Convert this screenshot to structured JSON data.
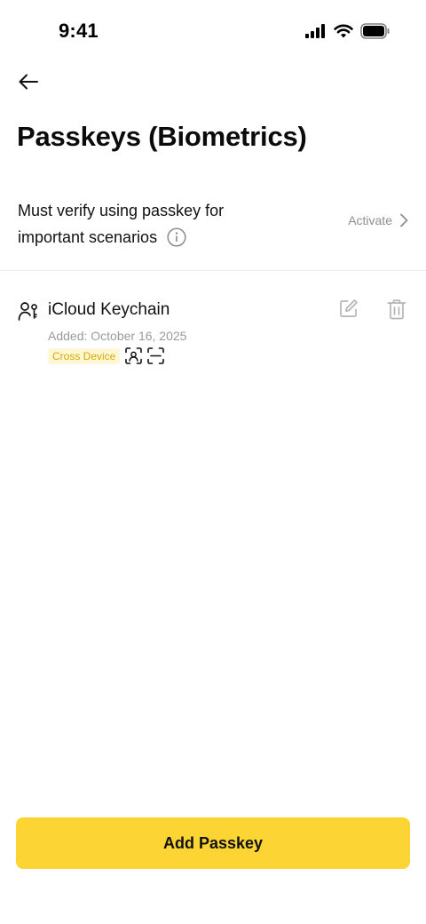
{
  "status_bar": {
    "time": "9:41"
  },
  "header": {
    "title": "Passkeys (Biometrics)"
  },
  "verification": {
    "label_line1": "Must verify using passkey for",
    "label_line2": "important scenarios",
    "action_label": "Activate"
  },
  "passkeys": [
    {
      "name": "iCloud Keychain",
      "added": "Added: October 16, 2025",
      "badge": "Cross Device"
    }
  ],
  "footer": {
    "add_button_label": "Add Passkey"
  },
  "colors": {
    "accent": "#fcd535",
    "badge_bg": "#fff7d6",
    "badge_text": "#d9a800",
    "muted_text": "#9a9a9a"
  }
}
